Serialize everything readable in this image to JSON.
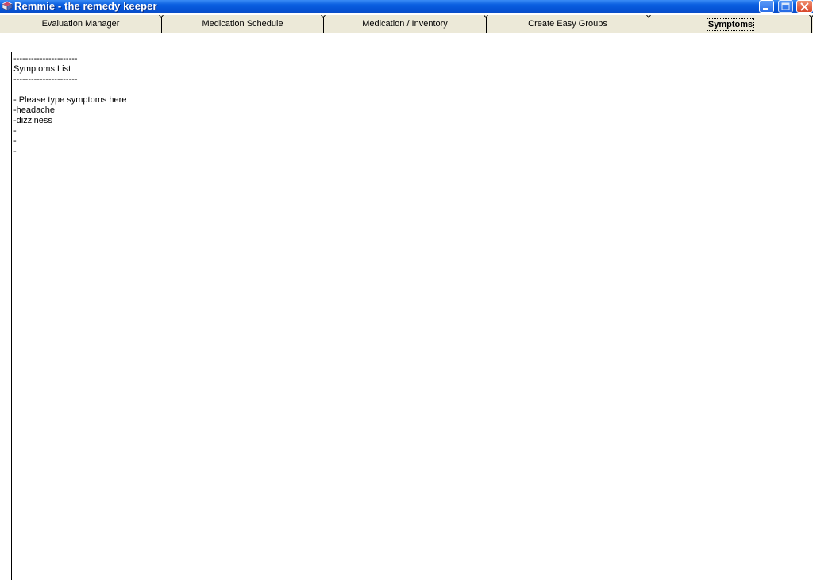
{
  "window": {
    "title": "Remmie - the remedy keeper",
    "app_icon": "book-icon",
    "controls": {
      "minimize": "minimize-icon",
      "maximize": "maximize-icon",
      "close": "close-icon"
    }
  },
  "tabs": [
    {
      "label": "Evaluation Manager",
      "active": false
    },
    {
      "label": "Medication Schedule",
      "active": false
    },
    {
      "label": "Medication / Inventory",
      "active": false
    },
    {
      "label": "Create Easy Groups",
      "active": false
    },
    {
      "label": "Symptoms",
      "active": true
    }
  ],
  "symptoms_editor": {
    "lines": [
      "----------------------",
      "Symptoms List",
      "----------------------",
      "",
      "- Please type symptoms here",
      "-headache",
      "-dizziness",
      "-",
      "-",
      "-"
    ]
  }
}
